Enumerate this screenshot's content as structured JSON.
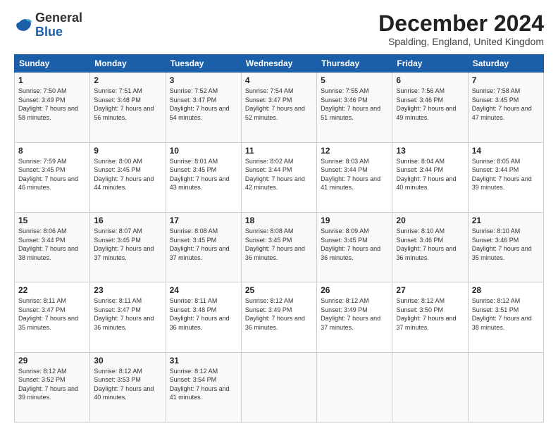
{
  "header": {
    "logo_line1": "General",
    "logo_line2": "Blue",
    "month_title": "December 2024",
    "location": "Spalding, England, United Kingdom"
  },
  "weekdays": [
    "Sunday",
    "Monday",
    "Tuesday",
    "Wednesday",
    "Thursday",
    "Friday",
    "Saturday"
  ],
  "weeks": [
    [
      {
        "day": "1",
        "sunrise": "Sunrise: 7:50 AM",
        "sunset": "Sunset: 3:49 PM",
        "daylight": "Daylight: 7 hours and 58 minutes."
      },
      {
        "day": "2",
        "sunrise": "Sunrise: 7:51 AM",
        "sunset": "Sunset: 3:48 PM",
        "daylight": "Daylight: 7 hours and 56 minutes."
      },
      {
        "day": "3",
        "sunrise": "Sunrise: 7:52 AM",
        "sunset": "Sunset: 3:47 PM",
        "daylight": "Daylight: 7 hours and 54 minutes."
      },
      {
        "day": "4",
        "sunrise": "Sunrise: 7:54 AM",
        "sunset": "Sunset: 3:47 PM",
        "daylight": "Daylight: 7 hours and 52 minutes."
      },
      {
        "day": "5",
        "sunrise": "Sunrise: 7:55 AM",
        "sunset": "Sunset: 3:46 PM",
        "daylight": "Daylight: 7 hours and 51 minutes."
      },
      {
        "day": "6",
        "sunrise": "Sunrise: 7:56 AM",
        "sunset": "Sunset: 3:46 PM",
        "daylight": "Daylight: 7 hours and 49 minutes."
      },
      {
        "day": "7",
        "sunrise": "Sunrise: 7:58 AM",
        "sunset": "Sunset: 3:45 PM",
        "daylight": "Daylight: 7 hours and 47 minutes."
      }
    ],
    [
      {
        "day": "8",
        "sunrise": "Sunrise: 7:59 AM",
        "sunset": "Sunset: 3:45 PM",
        "daylight": "Daylight: 7 hours and 46 minutes."
      },
      {
        "day": "9",
        "sunrise": "Sunrise: 8:00 AM",
        "sunset": "Sunset: 3:45 PM",
        "daylight": "Daylight: 7 hours and 44 minutes."
      },
      {
        "day": "10",
        "sunrise": "Sunrise: 8:01 AM",
        "sunset": "Sunset: 3:45 PM",
        "daylight": "Daylight: 7 hours and 43 minutes."
      },
      {
        "day": "11",
        "sunrise": "Sunrise: 8:02 AM",
        "sunset": "Sunset: 3:44 PM",
        "daylight": "Daylight: 7 hours and 42 minutes."
      },
      {
        "day": "12",
        "sunrise": "Sunrise: 8:03 AM",
        "sunset": "Sunset: 3:44 PM",
        "daylight": "Daylight: 7 hours and 41 minutes."
      },
      {
        "day": "13",
        "sunrise": "Sunrise: 8:04 AM",
        "sunset": "Sunset: 3:44 PM",
        "daylight": "Daylight: 7 hours and 40 minutes."
      },
      {
        "day": "14",
        "sunrise": "Sunrise: 8:05 AM",
        "sunset": "Sunset: 3:44 PM",
        "daylight": "Daylight: 7 hours and 39 minutes."
      }
    ],
    [
      {
        "day": "15",
        "sunrise": "Sunrise: 8:06 AM",
        "sunset": "Sunset: 3:44 PM",
        "daylight": "Daylight: 7 hours and 38 minutes."
      },
      {
        "day": "16",
        "sunrise": "Sunrise: 8:07 AM",
        "sunset": "Sunset: 3:45 PM",
        "daylight": "Daylight: 7 hours and 37 minutes."
      },
      {
        "day": "17",
        "sunrise": "Sunrise: 8:08 AM",
        "sunset": "Sunset: 3:45 PM",
        "daylight": "Daylight: 7 hours and 37 minutes."
      },
      {
        "day": "18",
        "sunrise": "Sunrise: 8:08 AM",
        "sunset": "Sunset: 3:45 PM",
        "daylight": "Daylight: 7 hours and 36 minutes."
      },
      {
        "day": "19",
        "sunrise": "Sunrise: 8:09 AM",
        "sunset": "Sunset: 3:45 PM",
        "daylight": "Daylight: 7 hours and 36 minutes."
      },
      {
        "day": "20",
        "sunrise": "Sunrise: 8:10 AM",
        "sunset": "Sunset: 3:46 PM",
        "daylight": "Daylight: 7 hours and 36 minutes."
      },
      {
        "day": "21",
        "sunrise": "Sunrise: 8:10 AM",
        "sunset": "Sunset: 3:46 PM",
        "daylight": "Daylight: 7 hours and 35 minutes."
      }
    ],
    [
      {
        "day": "22",
        "sunrise": "Sunrise: 8:11 AM",
        "sunset": "Sunset: 3:47 PM",
        "daylight": "Daylight: 7 hours and 35 minutes."
      },
      {
        "day": "23",
        "sunrise": "Sunrise: 8:11 AM",
        "sunset": "Sunset: 3:47 PM",
        "daylight": "Daylight: 7 hours and 36 minutes."
      },
      {
        "day": "24",
        "sunrise": "Sunrise: 8:11 AM",
        "sunset": "Sunset: 3:48 PM",
        "daylight": "Daylight: 7 hours and 36 minutes."
      },
      {
        "day": "25",
        "sunrise": "Sunrise: 8:12 AM",
        "sunset": "Sunset: 3:49 PM",
        "daylight": "Daylight: 7 hours and 36 minutes."
      },
      {
        "day": "26",
        "sunrise": "Sunrise: 8:12 AM",
        "sunset": "Sunset: 3:49 PM",
        "daylight": "Daylight: 7 hours and 37 minutes."
      },
      {
        "day": "27",
        "sunrise": "Sunrise: 8:12 AM",
        "sunset": "Sunset: 3:50 PM",
        "daylight": "Daylight: 7 hours and 37 minutes."
      },
      {
        "day": "28",
        "sunrise": "Sunrise: 8:12 AM",
        "sunset": "Sunset: 3:51 PM",
        "daylight": "Daylight: 7 hours and 38 minutes."
      }
    ],
    [
      {
        "day": "29",
        "sunrise": "Sunrise: 8:12 AM",
        "sunset": "Sunset: 3:52 PM",
        "daylight": "Daylight: 7 hours and 39 minutes."
      },
      {
        "day": "30",
        "sunrise": "Sunrise: 8:12 AM",
        "sunset": "Sunset: 3:53 PM",
        "daylight": "Daylight: 7 hours and 40 minutes."
      },
      {
        "day": "31",
        "sunrise": "Sunrise: 8:12 AM",
        "sunset": "Sunset: 3:54 PM",
        "daylight": "Daylight: 7 hours and 41 minutes."
      },
      null,
      null,
      null,
      null
    ]
  ]
}
